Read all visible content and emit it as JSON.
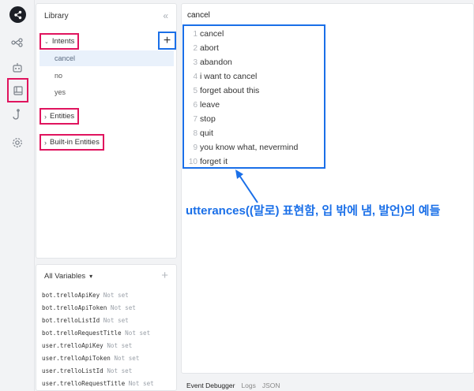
{
  "rail": {
    "icons": [
      "share-logo-icon",
      "flow-icon",
      "robot-icon",
      "library-icon",
      "hook-icon",
      "settings-icon"
    ]
  },
  "library": {
    "title": "Library",
    "collapse_glyph": "«",
    "sections": [
      {
        "label": "Intents",
        "expanded": true,
        "items": [
          "cancel",
          "no",
          "yes"
        ],
        "selected": "cancel"
      },
      {
        "label": "Entities",
        "expanded": false
      },
      {
        "label": "Built-in Entities",
        "expanded": false
      }
    ],
    "add_glyph": "+"
  },
  "variables": {
    "header": "All Variables",
    "add_glyph": "+",
    "items": [
      {
        "name": "bot.trelloApiKey",
        "status": "Not set"
      },
      {
        "name": "bot.trelloApiToken",
        "status": "Not set"
      },
      {
        "name": "bot.trelloListId",
        "status": "Not set"
      },
      {
        "name": "bot.trelloRequestTitle",
        "status": "Not set"
      },
      {
        "name": "user.trelloApiKey",
        "status": "Not set"
      },
      {
        "name": "user.trelloApiToken",
        "status": "Not set"
      },
      {
        "name": "user.trelloListId",
        "status": "Not set"
      },
      {
        "name": "user.trelloRequestTitle",
        "status": "Not set"
      }
    ]
  },
  "editor": {
    "title": "cancel",
    "utterances": [
      {
        "num": "1",
        "text": "cancel"
      },
      {
        "num": "2",
        "text": "abort"
      },
      {
        "num": "3",
        "text": "abandon"
      },
      {
        "num": "4",
        "text": "i want to cancel"
      },
      {
        "num": "5",
        "text": "forget about this"
      },
      {
        "num": "6",
        "text": "leave"
      },
      {
        "num": "7",
        "text": "stop"
      },
      {
        "num": "8",
        "text": "quit"
      },
      {
        "num": "9",
        "text": "you know what, nevermind"
      },
      {
        "num": "10",
        "text": "forget it"
      }
    ],
    "annotation": "utterances((말로) 표현함, 입 밖에 냄, 발언)의 예들"
  },
  "bottom_tabs": [
    "Event Debugger",
    "Logs",
    "JSON"
  ],
  "colors": {
    "highlight_red": "#e0145e",
    "highlight_blue": "#1a6fe8",
    "selected_row": "#e9f1fb"
  }
}
